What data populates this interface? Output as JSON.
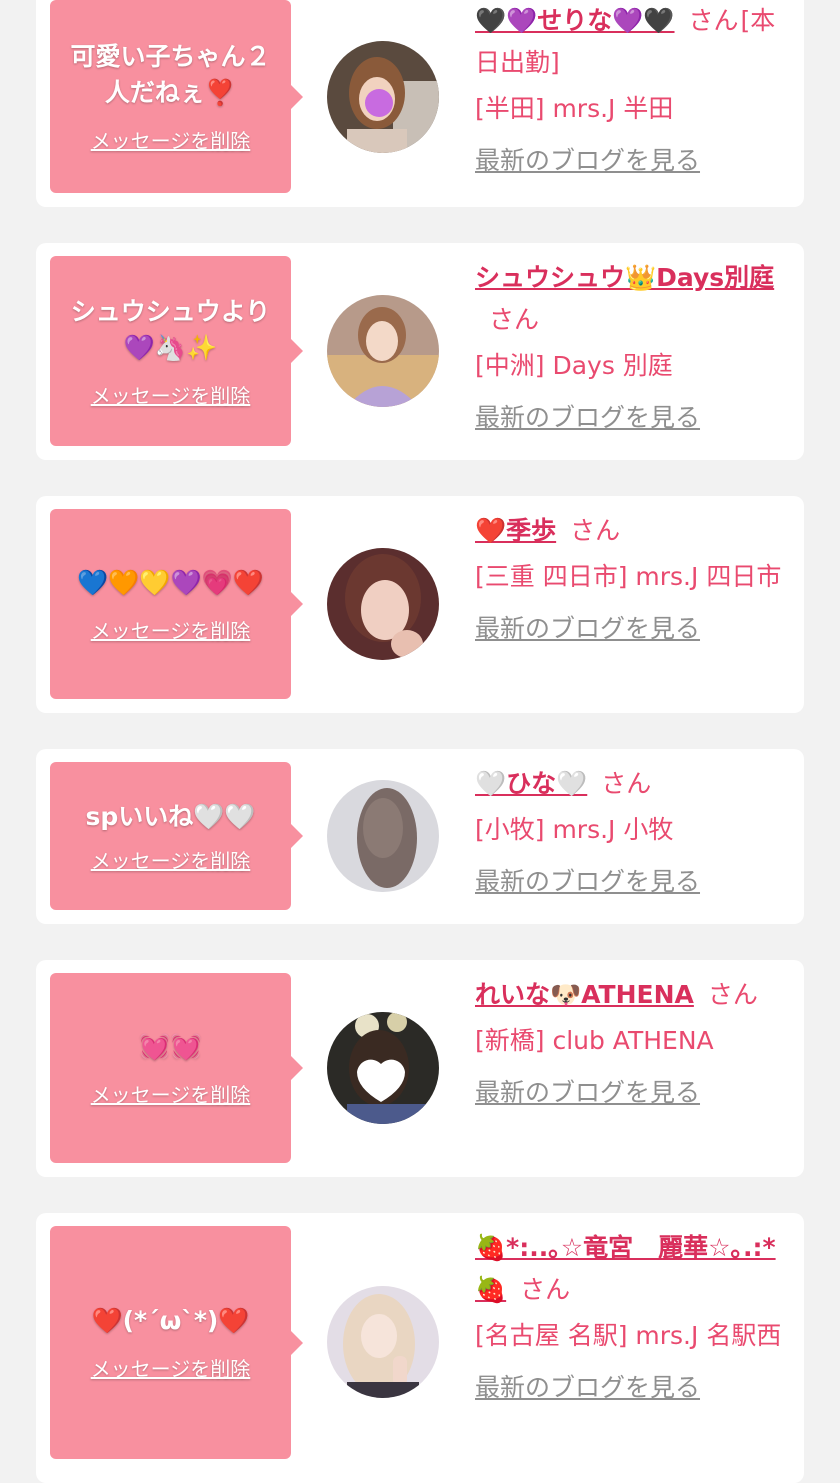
{
  "delete_label": "メッセージを削除",
  "san_label": "さん",
  "blog_label": "最新のブログを見る",
  "colors": {
    "background": "#f2f2f2",
    "bubble": "#f8909f",
    "accent": "#e94a6f",
    "link_gray": "#8f8f8f"
  },
  "messages": [
    {
      "text": "可愛い子ちゃん２人だねぇ❣️",
      "name": "🖤💜せりな💜🖤",
      "shop": "[半田] mrs.J 半田",
      "avatar_icon": "girl-photo-avatar"
    },
    {
      "text": "シュウシュウより💜🦄✨",
      "name": "シュウシュウ👑Days別庭",
      "shop": "[中洲] Days 別庭",
      "avatar_icon": "girl-photo-avatar"
    },
    {
      "text": "💙🧡💛💜💗❤️",
      "name": "❤️季歩",
      "shop": "[三重 四日市] mrs.J 四日市",
      "avatar_icon": "girl-photo-avatar"
    },
    {
      "text": "spいいね🤍🤍",
      "name": "🤍ひな🤍",
      "shop": "[小牧] mrs.J 小牧",
      "avatar_icon": "girl-photo-avatar"
    },
    {
      "text": "💓💓",
      "name": "れいな🐶ATHENA",
      "shop": "[新橋] club ATHENA",
      "avatar_icon": "girl-photo-avatar"
    },
    {
      "text": "❤️(*´ω`*)❤️",
      "name": "🍓*:..｡☆竜宮　麗華☆｡.:*🍓",
      "shop": "[名古屋 名駅] mrs.J 名駅西",
      "avatar_icon": "girl-photo-avatar"
    }
  ]
}
